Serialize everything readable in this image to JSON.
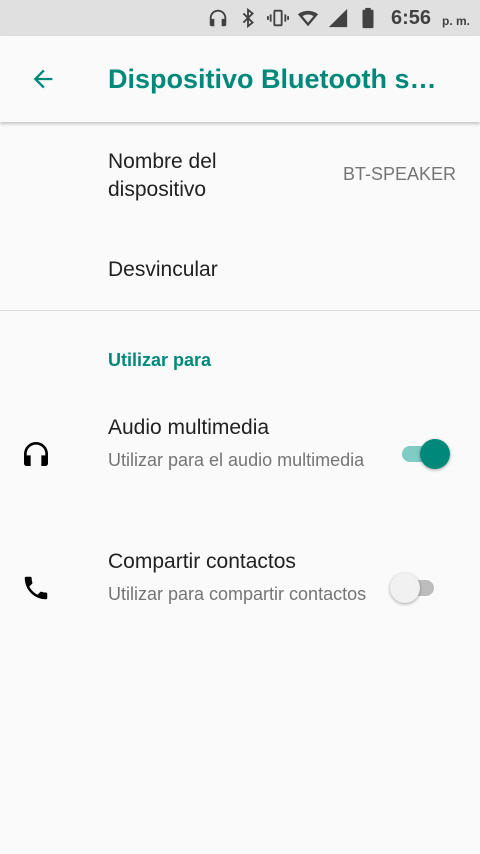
{
  "status_bar": {
    "icons": [
      "headphones-icon",
      "bluetooth-icon",
      "vibrate-icon",
      "wifi-icon",
      "cell-signal-icon",
      "battery-icon"
    ],
    "time": "6:56",
    "ampm": "p. m."
  },
  "app_bar": {
    "back_icon": "arrow-back-icon",
    "title": "Dispositivo Bluetooth s…"
  },
  "device": {
    "name_label": "Nombre del dispositivo",
    "name_value": "BT-SPEAKER",
    "unpair_label": "Desvincular"
  },
  "section": {
    "header": "Utilizar para"
  },
  "preferences": [
    {
      "icon": "headphones-icon",
      "title": "Audio multimedia",
      "summary": "Utilizar para el audio multimedia",
      "enabled": true
    },
    {
      "icon": "phone-icon",
      "title": "Compartir contactos",
      "summary": "Utilizar para compartir contactos",
      "enabled": false
    }
  ],
  "colors": {
    "accent": "#00897b",
    "accent_light": "#80cbc4",
    "background": "#fafafa",
    "status_bar": "#e0e0e0",
    "secondary_text": "#757575"
  }
}
